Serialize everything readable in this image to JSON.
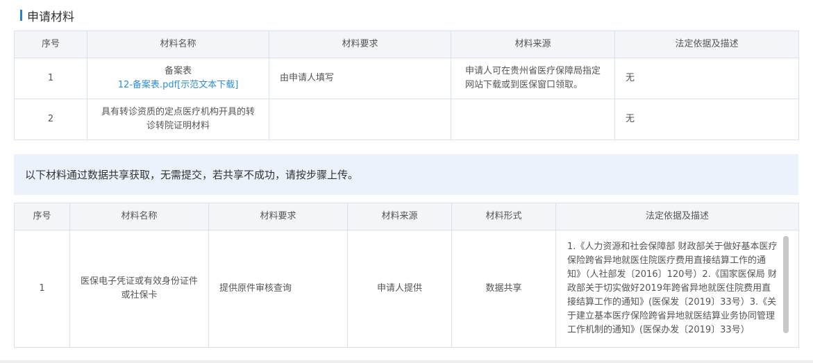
{
  "section_title": "申请材料",
  "table1": {
    "headers": [
      "序号",
      "材料名称",
      "材料要求",
      "材料来源",
      "法定依据及描述"
    ],
    "rows": [
      {
        "no": "1",
        "name": "备案表",
        "link": "12-备案表.pdf[示范文本下载]",
        "requirement": "由申请人填写",
        "source": "申请人可在贵州省医疗保障局指定网站下载或到医保窗口领取。",
        "legal": "无"
      },
      {
        "no": "2",
        "name": "具有转诊资质的定点医疗机构开具的转诊转院证明材料",
        "requirement": "",
        "source": "",
        "legal": "无"
      }
    ]
  },
  "notice": "以下材料通过数据共享获取，无需提交，若共享不成功，请按步骤上传。",
  "table2": {
    "headers": [
      "序号",
      "材料名称",
      "材料要求",
      "材料来源",
      "材料形式",
      "法定依据及描述"
    ],
    "rows": [
      {
        "no": "1",
        "name": "医保电子凭证或有效身份证件或社保卡",
        "requirement": "提供原件审核查询",
        "source": "申请人提供",
        "form": "数据共享",
        "legal": "1.《人力资源和社会保障部 财政部关于做好基本医疗保险跨省异地就医住院医疗费用直接结算工作的通知》（人社部发〔2016〕120号）2.《国家医保局 财政部关于切实做好2019年跨省异地就医住院费用直接结算工作的通知》(医保发〔2019〕33号）3.《关于建立基本医疗保险跨省异地就医结算业务协同管理工作机制的通知》(医保办发〔2019〕33号）"
      }
    ]
  },
  "colors": {
    "accent": "#2a7fd4",
    "link": "#2a8fd8",
    "notice_bg": "#ebf2fb",
    "header_bg": "#f3f5f8",
    "border": "#d8e2ee"
  }
}
